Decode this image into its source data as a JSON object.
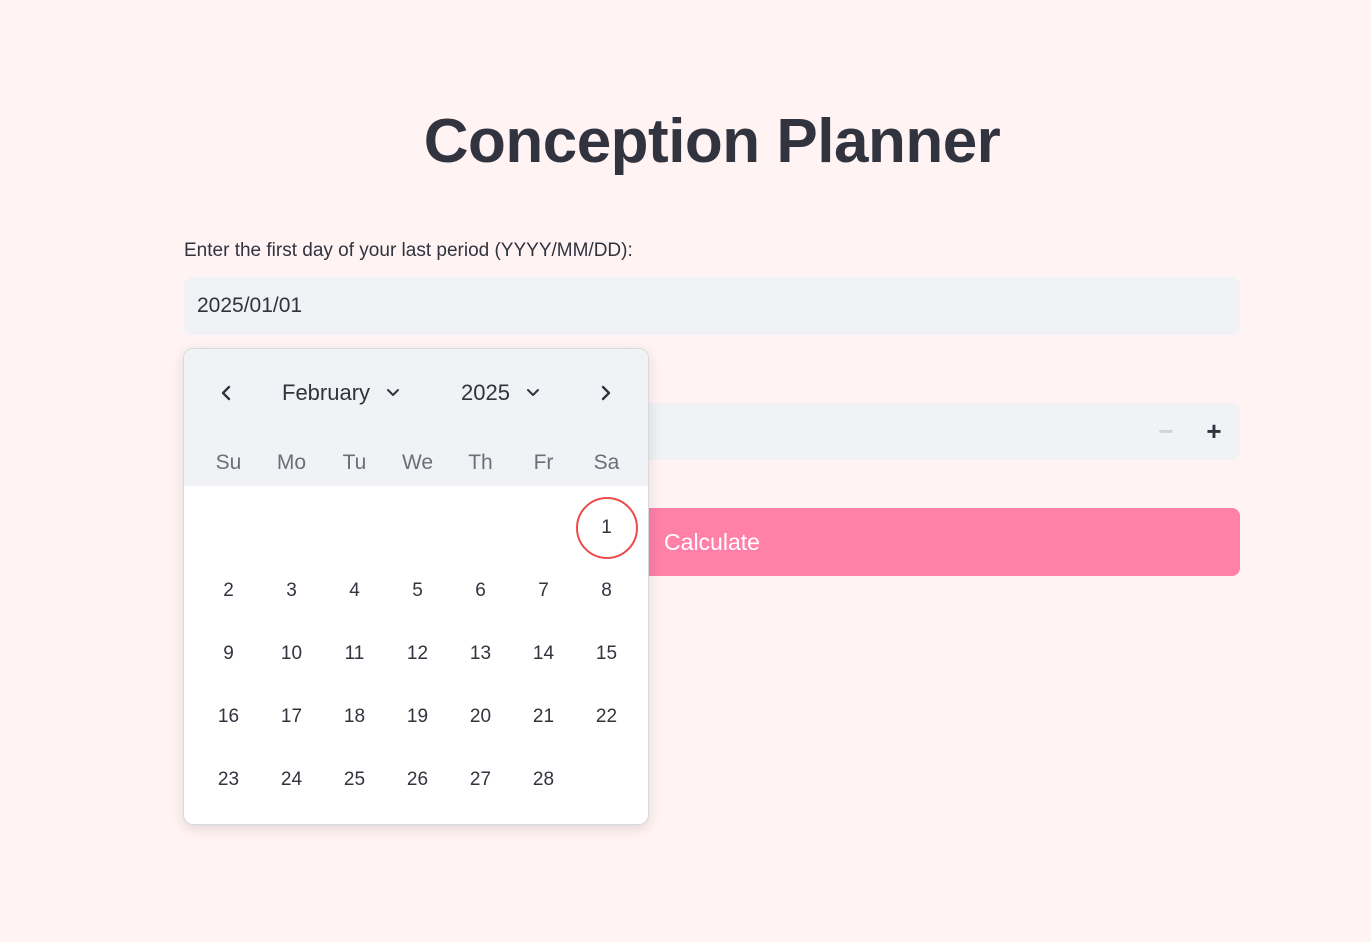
{
  "title": "Conception Planner",
  "date_label": "Enter the first day of your last period (YYYY/MM/DD):",
  "date_value": "2025/01/01",
  "stepper": {
    "minus": "−",
    "plus": "+"
  },
  "calculate_label": "Calculate",
  "calendar": {
    "month": "February",
    "year": "2025",
    "weekdays": [
      "Su",
      "Mo",
      "Tu",
      "We",
      "Th",
      "Fr",
      "Sa"
    ],
    "leading_blanks": 6,
    "days": [
      "1",
      "2",
      "3",
      "4",
      "5",
      "6",
      "7",
      "8",
      "9",
      "10",
      "11",
      "12",
      "13",
      "14",
      "15",
      "16",
      "17",
      "18",
      "19",
      "20",
      "21",
      "22",
      "23",
      "24",
      "25",
      "26",
      "27",
      "28"
    ],
    "highlighted_day": "1"
  },
  "colors": {
    "background": "#fff4f3",
    "button": "#ff80a8",
    "highlight_ring": "#ee4a4a",
    "field": "#f0f2f6"
  }
}
